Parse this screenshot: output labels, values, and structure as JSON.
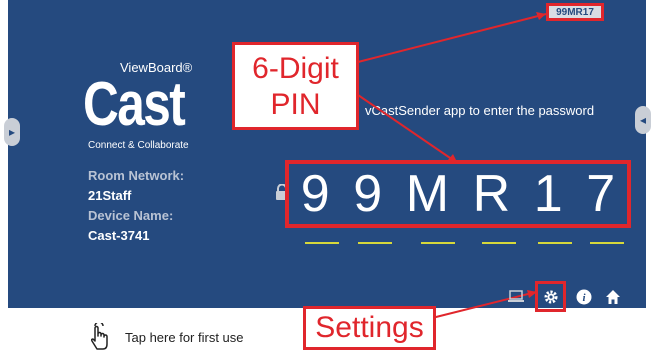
{
  "brand": {
    "small": "ViewBoard®",
    "big": "Cast",
    "tagline": "Connect & Collaborate"
  },
  "info": {
    "room_network_label": "Room Network:",
    "room_network_value": "21Staff",
    "device_name_label": "Device Name:",
    "device_name_value": "Cast-3741"
  },
  "instruction": "vCastSender app to enter the password",
  "pin": {
    "chars": [
      "9",
      "9",
      "M",
      "R",
      "1",
      "7"
    ],
    "top_badge": "99MR17"
  },
  "callouts": {
    "pin_line1": "6-Digit",
    "pin_line2": "PIN",
    "settings": "Settings"
  },
  "toolbar": {
    "icons": [
      "laptop-icon",
      "gear-icon",
      "info-icon",
      "home-icon"
    ]
  },
  "first_use": {
    "label": "Tap here for first use",
    "icon": "hand-tap-icon"
  },
  "colors": {
    "background": "#254a7f",
    "highlight": "#e0262c",
    "pin_underline": "#d6d83b"
  }
}
